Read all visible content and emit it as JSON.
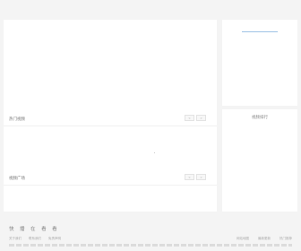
{
  "main": {
    "section_1": {
      "title": "热门视频",
      "prev": "<",
      "next": ">"
    },
    "section_2": {
      "title": "视频广场",
      "prev": "<",
      "next": ">"
    }
  },
  "sidebar": {
    "bottom_title": "视频排行"
  },
  "footer": {
    "brand": "快 播 在 看 看",
    "links": [
      "关于我们",
      "联系我们",
      "免责声明"
    ],
    "right_links": [
      "网站地图",
      "最新更新",
      "热门推荐"
    ]
  }
}
